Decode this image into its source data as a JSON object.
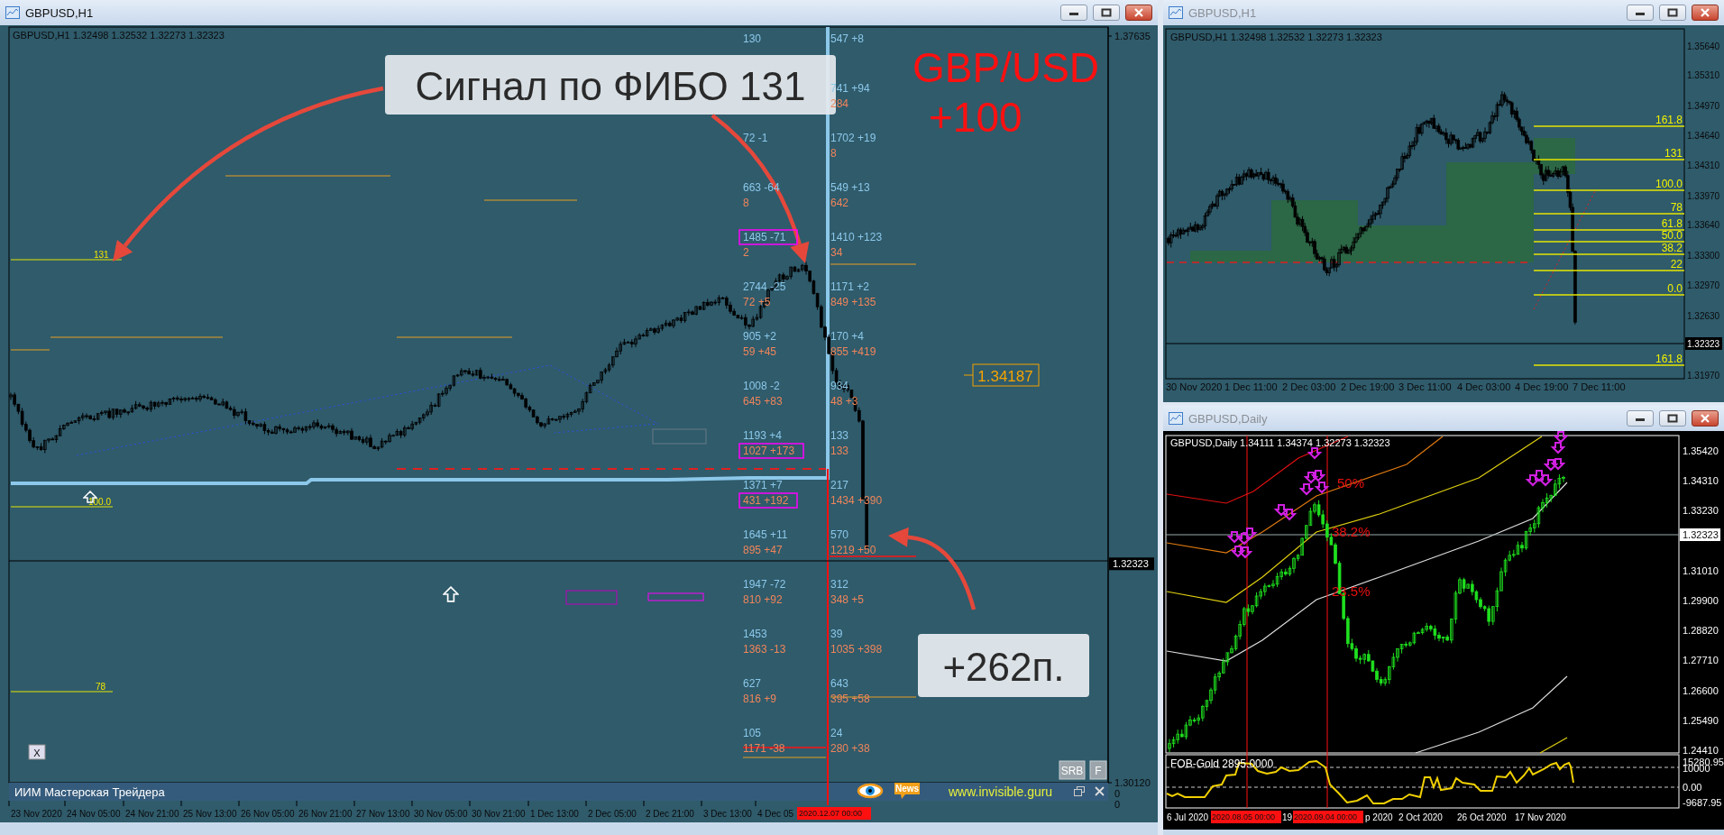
{
  "main_window": {
    "title": "GBPUSD,H1",
    "active": true,
    "info": "GBPUSD,H1  1.32498 1.32532 1.32273 1.32323",
    "price_axis": [
      "1.37635",
      "1.30120"
    ],
    "axis_zeros": [
      "0",
      "0"
    ],
    "current_price": "1.32323",
    "headline": [
      "GBP/USD",
      "+100"
    ],
    "callouts": [
      "Сигнал по ФИБО 131",
      "+262п."
    ],
    "price_tag": "1.34187",
    "fib_levels": [
      "131",
      "100.0",
      "78"
    ],
    "levels_left": [
      {
        "upper": "130"
      },
      {
        "upper": "72 -1"
      },
      {
        "upper": "663 -64",
        "lower": "8"
      },
      {
        "upper": "1485 -71",
        "lower": "2",
        "box_upper": true
      },
      {
        "upper": "2744 -25",
        "lower": "72 +5"
      },
      {
        "upper": "905 +2",
        "lower": "59 +45"
      },
      {
        "upper": "1008 -2",
        "lower": "645 +83"
      },
      {
        "upper": "1193 +4",
        "lower": "1027 +173",
        "box_lower": true
      },
      {
        "upper": "1371 +7",
        "lower": "431 +192",
        "box_lower": true
      },
      {
        "upper": "1645 +11",
        "lower": "895 +47"
      },
      {
        "upper": "1947 -72",
        "lower": "810 +92"
      },
      {
        "upper": "1453",
        "lower": "1363 -13"
      },
      {
        "upper": "627",
        "lower": "816 +9"
      },
      {
        "upper": "105",
        "lower": "1171 -38"
      }
    ],
    "levels_right": [
      {
        "upper": "547 +8"
      },
      {
        "upper": "741 +94",
        "lower": "284"
      },
      {
        "upper": "1702 +19",
        "lower": "8"
      },
      {
        "upper": "549 +13",
        "lower": "642"
      },
      {
        "upper": "1410 +123",
        "lower": "34"
      },
      {
        "upper": "1171 +2",
        "lower": "849 +135"
      },
      {
        "upper": "170 +4",
        "lower": "855 +419"
      },
      {
        "upper": "934",
        "lower": "48 +3"
      },
      {
        "upper": "133",
        "lower": "133"
      },
      {
        "upper": "217",
        "lower": "1434 +390"
      },
      {
        "upper": "570",
        "lower": "1219 +50"
      },
      {
        "upper": "312",
        "lower": "348 +5"
      },
      {
        "upper": "39",
        "lower": "1035 +398"
      },
      {
        "upper": "643",
        "lower": "395 +58"
      },
      {
        "upper": "24",
        "lower": "280 +38"
      }
    ],
    "buttons": [
      "SRB",
      "F"
    ],
    "close_box": "X",
    "footer": {
      "title": "ИИМ Мастерская Трейдера",
      "news": "News",
      "url": "www.invisible.guru"
    },
    "time_axis": [
      {
        "text": "23 Nov 2020",
        "marked": false
      },
      {
        "text": "24 Nov 05:00",
        "marked": false
      },
      {
        "text": "24 Nov 21:00",
        "marked": false
      },
      {
        "text": "25 Nov 13:00",
        "marked": false
      },
      {
        "text": "26 Nov 05:00",
        "marked": false
      },
      {
        "text": "26 Nov 21:00",
        "marked": false
      },
      {
        "text": "27 Nov 13:00",
        "marked": false
      },
      {
        "text": "30 Nov 05:00",
        "marked": false
      },
      {
        "text": "30 Nov 21:00",
        "marked": false
      },
      {
        "text": "1 Dec 13:00",
        "marked": false
      },
      {
        "text": "2 Dec 05:00",
        "marked": false
      },
      {
        "text": "2 Dec 21:00",
        "marked": false
      },
      {
        "text": "3 Dec 13:00",
        "marked": false
      },
      {
        "text": "4 Dec 05",
        "marked": false
      },
      {
        "text": "2020.12.07 00:00",
        "marked": true
      }
    ]
  },
  "h1_window": {
    "title": "GBPUSD,H1",
    "active": false,
    "info": "GBPUSD,H1  1.32498 1.32532 1.32273 1.32323",
    "price_axis": [
      "1.35640",
      "1.35310",
      "1.34970",
      "1.34640",
      "1.34310",
      "1.33970",
      "1.33640",
      "1.33300",
      "1.32970",
      "1.32630",
      "1.31970"
    ],
    "current_price": "1.32323",
    "fib_levels": [
      "161.8",
      "131",
      "100.0",
      "78",
      "61.8",
      "50.0",
      "38.2",
      "22",
      "0.0",
      "161.8"
    ],
    "time_axis": [
      "30 Nov 2020",
      "1 Dec 11:00",
      "2 Dec 03:00",
      "2 Dec 19:00",
      "3 Dec 11:00",
      "4 Dec 03:00",
      "4 Dec 19:00",
      "7 Dec 11:00"
    ]
  },
  "daily_window": {
    "title": "GBPUSD,Daily",
    "active": false,
    "info": "GBPUSD,Daily  1.34111 1.34374 1.32273 1.32323",
    "price_axis": [
      "1.35420",
      "1.34310",
      "1.33230",
      "1.31010",
      "1.29900",
      "1.28820",
      "1.27710",
      "1.26600",
      "1.25490",
      "1.24410"
    ],
    "current_price": "1.32323",
    "percent_levels": [
      "50%",
      "38.2%",
      "23.5%"
    ],
    "indicator": {
      "title": "FOB-Gold 2895.0000",
      "scale": [
        "15280.95",
        "10000",
        "0.00",
        "-9687.95"
      ]
    },
    "time_axis": [
      {
        "text": "6 Jul 2020",
        "marked": false
      },
      {
        "text": "2020.08.05 00:00",
        "marked": true
      },
      {
        "text": "19",
        "marked": false
      },
      {
        "text": "2020.09.04 00:00",
        "marked": true
      },
      {
        "text": "p 2020",
        "marked": false
      },
      {
        "text": "2 Oct 2020",
        "marked": false
      },
      {
        "text": "26 Oct 2020",
        "marked": false
      },
      {
        "text": "17 Nov 2020",
        "marked": false
      }
    ]
  }
}
